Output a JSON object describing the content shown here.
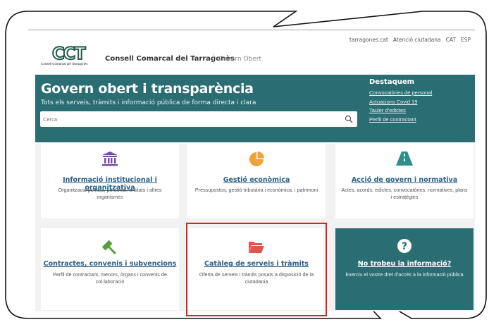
{
  "top_links": [
    "tarragones.cat",
    "Atenció ciutadana",
    "CAT",
    "ESP"
  ],
  "logo": {
    "mark": "CCT",
    "subtitle": "Consell Comarcal del Tarragonès"
  },
  "org": {
    "name": "Consell Comarcal del Tarragonès",
    "tag": "Govern Obert"
  },
  "hero": {
    "title": "Govern obert i transparència",
    "subtitle": "Tots els serveis, tràmits i informació pública de forma directa i clara",
    "search_placeholder": "Cerca",
    "featured_title": "Destaquem",
    "featured_links": [
      "Convocatòries de personal",
      "Actuacions Covid 19",
      "Tauler d'edictes",
      "Perfil de contractant"
    ]
  },
  "cards": [
    {
      "title": "Informació institucional i organitzativa",
      "desc": "Organització política, personal, entitats i altres organismes",
      "icon": "institution-icon"
    },
    {
      "title": "Gestió econòmica",
      "desc": "Pressupostos, gestió tributària i econòmica, i patrimoni",
      "icon": "pie-chart-icon"
    },
    {
      "title": "Acció de govern i normativa",
      "desc": "Actes, acords, edictes, convocatòries, normatives, plans i estratègies",
      "icon": "road-icon"
    },
    {
      "title": "Contractes, convenis i subvencions",
      "desc": "Perfil de contractant, menors, òrgans i convenis de col·laboració",
      "icon": "gavel-icon"
    },
    {
      "title": "Catàleg de serveis i tràmits",
      "desc": "Oferta de serveis i tràmits posats a disposició de la ciutadania",
      "icon": "folder-open-icon"
    },
    {
      "title": "No trobeu la informació?",
      "desc": "Exerciu el vostre dret d'accés a la informació pública",
      "icon": "question-circle-icon"
    }
  ],
  "colors": {
    "teal": "#2a6e74",
    "link": "#2a5f88",
    "highlight": "#e0201f",
    "icon_purple": "#7a4f9c",
    "icon_orange": "#f1a23a",
    "icon_teal": "#2d8e8e",
    "icon_green": "#5a9e3a",
    "icon_red": "#e2554a"
  }
}
